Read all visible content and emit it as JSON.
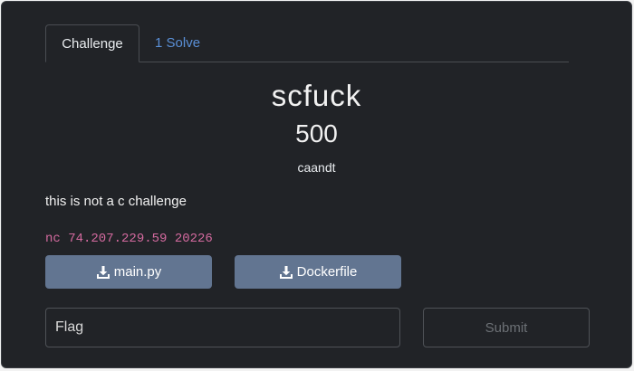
{
  "tabs": [
    {
      "label": "Challenge"
    },
    {
      "label": "1 Solve"
    }
  ],
  "challenge": {
    "name": "scfuck",
    "value": "500",
    "author": "caandt",
    "description": "this is not a c challenge",
    "connection": "nc 74.207.229.59 20226"
  },
  "files": [
    {
      "label": "main.py",
      "icon": "download-icon"
    },
    {
      "label": "Dockerfile",
      "icon": "download-icon"
    }
  ],
  "form": {
    "flag_placeholder": "Flag",
    "submit_label": "Submit"
  },
  "colors": {
    "background": "#212327",
    "accent_link": "#5a8fd6",
    "file_button": "#627591",
    "code_text": "#d46a9f"
  }
}
